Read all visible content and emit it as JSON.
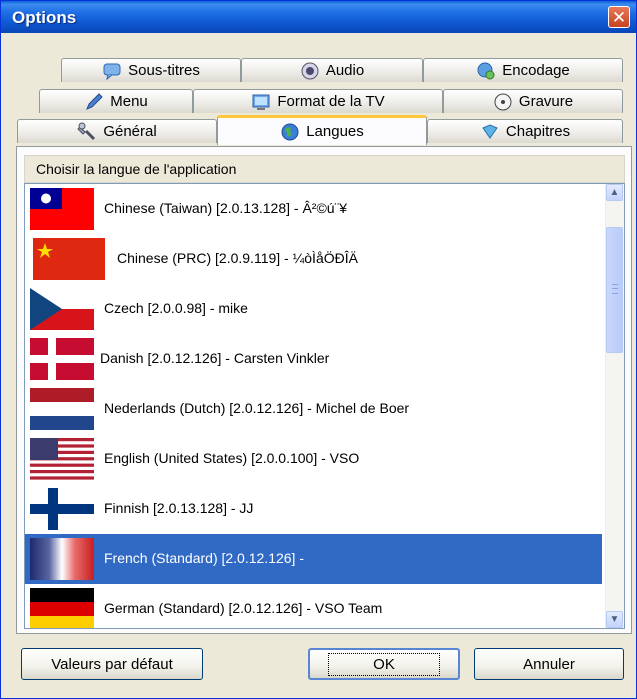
{
  "window": {
    "title": "Options"
  },
  "tabs": {
    "row1": [
      {
        "label": "Sous-titres",
        "icon": "subtitles-icon"
      },
      {
        "label": "Audio",
        "icon": "speaker-icon"
      },
      {
        "label": "Encodage",
        "icon": "encoding-icon"
      }
    ],
    "row2": [
      {
        "label": "Menu",
        "icon": "pen-icon"
      },
      {
        "label": "Format de la TV",
        "icon": "tv-icon"
      },
      {
        "label": "Gravure",
        "icon": "disc-icon"
      }
    ],
    "row3": [
      {
        "label": "Général",
        "icon": "tools-icon"
      },
      {
        "label": "Langues",
        "icon": "globe-icon",
        "active": true
      },
      {
        "label": "Chapitres",
        "icon": "book-icon"
      }
    ]
  },
  "panel": {
    "header": "Choisir la langue de l'application"
  },
  "languages": [
    {
      "label": "Chinese (Taiwan) [2.0.13.128] - Â²©ú¨¥",
      "flag": "tw"
    },
    {
      "label": "Chinese (PRC) [2.0.9.119] - ¼òÌåÖÐÎÄ",
      "flag": "cn"
    },
    {
      "label": "Czech [2.0.0.98] - mike",
      "flag": "cz"
    },
    {
      "label": "Danish [2.0.12.126] - Carsten Vinkler",
      "flag": "dk"
    },
    {
      "label": "Nederlands (Dutch) [2.0.12.126] - Michel de Boer",
      "flag": "nl"
    },
    {
      "label": "English (United States) [2.0.0.100] - VSO",
      "flag": "us"
    },
    {
      "label": "Finnish [2.0.13.128] - JJ",
      "flag": "fi"
    },
    {
      "label": "French (Standard) [2.0.12.126] -",
      "flag": "fr",
      "selected": true
    },
    {
      "label": "German (Standard) [2.0.12.126] - VSO Team",
      "flag": "de"
    }
  ],
  "buttons": {
    "defaults": "Valeurs par défaut",
    "ok": "OK",
    "cancel": "Annuler"
  }
}
